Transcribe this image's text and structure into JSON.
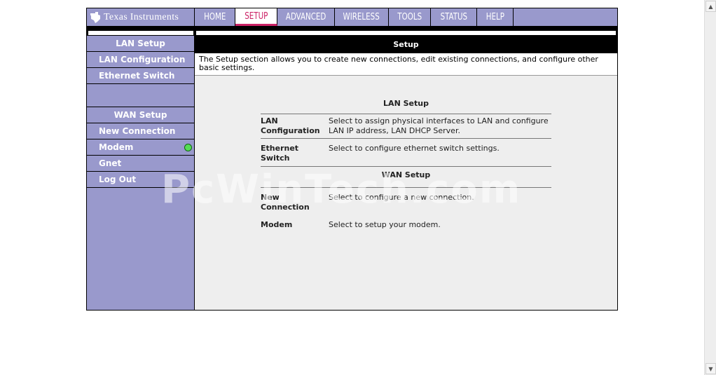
{
  "brand": {
    "name": "Texas Instruments"
  },
  "nav": {
    "tabs": [
      {
        "label": "HOME"
      },
      {
        "label": "SETUP"
      },
      {
        "label": "ADVANCED"
      },
      {
        "label": "WIRELESS"
      },
      {
        "label": "TOOLS"
      },
      {
        "label": "STATUS"
      },
      {
        "label": "HELP"
      }
    ],
    "active": "SETUP"
  },
  "sidebar": {
    "lan_header": "LAN Setup",
    "lan_items": [
      "LAN Configuration",
      "Ethernet Switch"
    ],
    "wan_header": "WAN Setup",
    "wan_items": [
      "New Connection",
      "Modem",
      "Gnet",
      "Log Out"
    ],
    "modem_status_color": "#55dd55"
  },
  "main": {
    "title": "Setup",
    "intro": "The Setup section allows you to create new connections, edit existing connections, and configure other basic settings.",
    "lan_section": {
      "title": "LAN Setup",
      "rows": [
        {
          "label": "LAN Configuration",
          "desc": "Select to assign physical interfaces to LAN and configure LAN IP address, LAN DHCP Server."
        },
        {
          "label": "Ethernet Switch",
          "desc": "Select to configure ethernet switch settings."
        }
      ]
    },
    "wan_section": {
      "title": "WAN Setup",
      "rows": [
        {
          "label": "New Connection",
          "desc": "Select to configure a new connection."
        },
        {
          "label": "Modem",
          "desc": "Select to setup your modem."
        }
      ]
    }
  },
  "watermark": "PcWinTech.com",
  "colors": {
    "nav_bg": "#9999cc",
    "active_tab": "#cc2266"
  }
}
